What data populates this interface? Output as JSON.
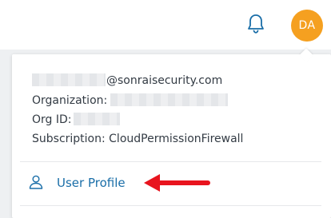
{
  "header": {
    "bell_icon": "bell-icon",
    "avatar_initials": "DA"
  },
  "profile_menu": {
    "email_domain": "@sonraisecurity.com",
    "organization_label": "Organization:",
    "org_id_label": "Org ID:",
    "subscription_text": "Subscription: CloudPermissionFirewall",
    "user_profile_label": "User Profile",
    "user_profile_icon": "user-icon"
  },
  "annotation": {
    "arrow_icon": "arrow-left-icon"
  },
  "colors": {
    "accent": "#1a6ea8",
    "avatar_bg": "#f5a020",
    "arrow": "#e8141e",
    "text": "#333b44"
  }
}
